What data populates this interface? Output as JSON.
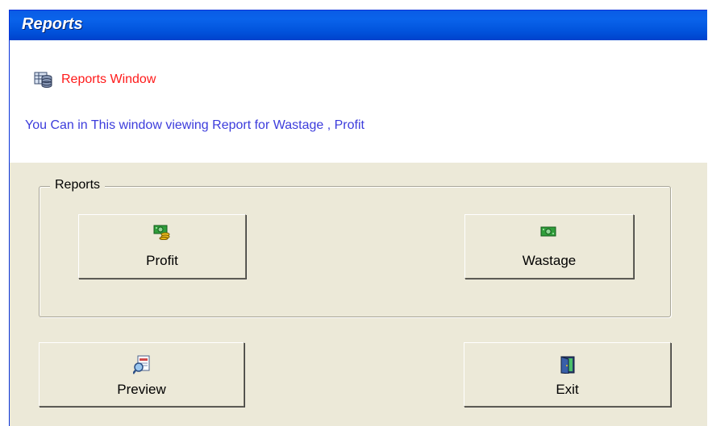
{
  "window": {
    "title": "Reports"
  },
  "banner": {
    "heading": "Reports Window",
    "description": "You Can in This window viewing Report for  Wastage ,  Profit"
  },
  "reports_group": {
    "legend": "Reports",
    "profit_label": "Profit",
    "wastage_label": "Wastage"
  },
  "actions": {
    "preview_label": "Preview",
    "exit_label": "Exit"
  },
  "colors": {
    "title_bar": "#0153dc",
    "heading": "#ff1a1a",
    "description": "#3c3cdc",
    "panel": "#ece9d8"
  },
  "icons": {
    "banner": "database-table-icon",
    "profit": "money-coins-icon",
    "wastage": "money-icon",
    "preview": "preview-document-icon",
    "exit": "exit-door-icon"
  }
}
